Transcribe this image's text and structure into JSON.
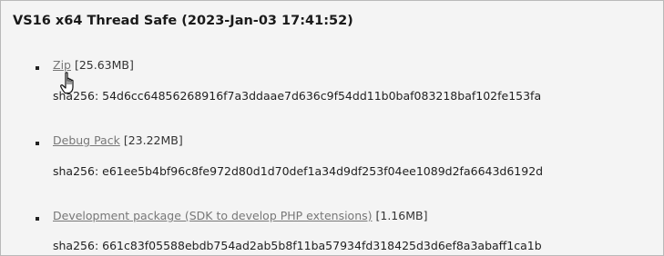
{
  "section": {
    "title": "VS16 x64 Thread Safe (2023-Jan-03 17:41:52)"
  },
  "downloads": [
    {
      "link_label": "Zip",
      "size": "[25.63MB]",
      "sha": "sha256: 54d6cc64856268916f7a3ddaae7d636c9f54dd11b0baf083218baf102fe153fa"
    },
    {
      "link_label": "Debug Pack",
      "size": "[23.22MB]",
      "sha": "sha256: e61ee5b4bf96c8fe972d80d1d70def1a34d9df253f04ee1089d2fa6643d6192d"
    },
    {
      "link_label": "Development package (SDK to develop PHP extensions)",
      "size": "[1.16MB]",
      "sha": "sha256: 661c83f05588ebdb754ad2ab5b8f11ba57934fd318425d3d6ef8a3abaff1ca1b"
    }
  ],
  "cursor": {
    "icon": "hand-pointer-icon"
  },
  "colors": {
    "background": "#f4f4f4",
    "link": "#777777",
    "text": "#1f1f1f"
  }
}
